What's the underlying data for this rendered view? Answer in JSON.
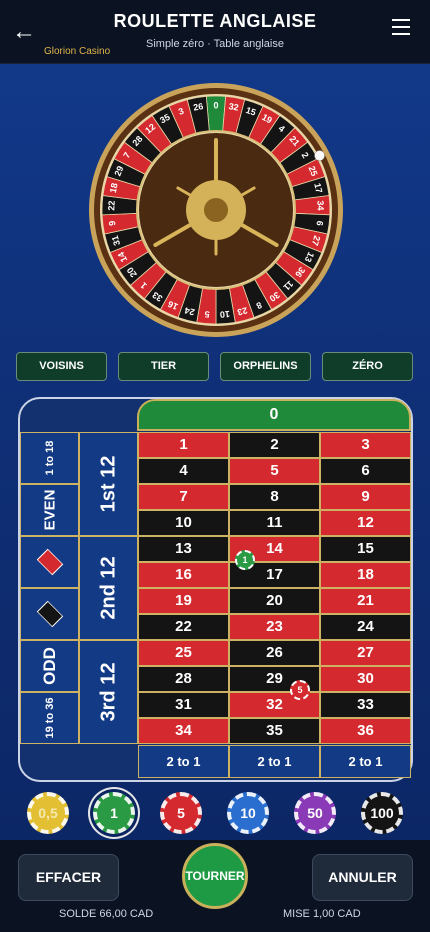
{
  "header": {
    "back_icon": "arrow-left-icon",
    "back_glyph": "←",
    "title": "ROULETTE ANGLAISE",
    "subtitle": "Simple zéro · Table anglaise",
    "brand": "Glorion Casino",
    "menu_icon": "hamburger-icon"
  },
  "wheel": {
    "sequence": [
      0,
      32,
      15,
      19,
      4,
      21,
      2,
      25,
      17,
      34,
      6,
      27,
      13,
      36,
      11,
      30,
      8,
      23,
      10,
      5,
      24,
      16,
      33,
      1,
      20,
      14,
      31,
      9,
      22,
      18,
      29,
      7,
      28,
      12,
      35,
      3,
      26
    ],
    "red_numbers": [
      1,
      3,
      5,
      7,
      9,
      12,
      14,
      16,
      18,
      19,
      21,
      23,
      25,
      27,
      30,
      32,
      34,
      36
    ],
    "colors": {
      "red": "#d42a2f",
      "black": "#141414",
      "green": "#1f8a3a",
      "gold": "#c9a35a",
      "wood": "#5a3213"
    }
  },
  "quick_bets": [
    "VOISINS",
    "TIER",
    "ORPHELINS",
    "ZÉRO"
  ],
  "table": {
    "zero": "0",
    "rows": [
      [
        "1",
        "2",
        "3"
      ],
      [
        "4",
        "5",
        "6"
      ],
      [
        "7",
        "8",
        "9"
      ],
      [
        "10",
        "11",
        "12"
      ],
      [
        "13",
        "14",
        "15"
      ],
      [
        "16",
        "17",
        "18"
      ],
      [
        "19",
        "20",
        "21"
      ],
      [
        "22",
        "23",
        "24"
      ],
      [
        "25",
        "26",
        "27"
      ],
      [
        "28",
        "29",
        "30"
      ],
      [
        "31",
        "32",
        "33"
      ],
      [
        "34",
        "35",
        "36"
      ]
    ],
    "dozens": [
      "1st 12",
      "2nd 12",
      "3rd 12"
    ],
    "low": "1 to 18",
    "even": "EVEN",
    "red_icon": "red-diamond-icon",
    "black_icon": "black-diamond-icon",
    "odd": "ODD",
    "high": "19 to 36",
    "columns": [
      "2 to 1",
      "2 to 1",
      "2 to 1"
    ],
    "placed_chips": [
      {
        "value": "1",
        "on": "14"
      },
      {
        "value": "5",
        "on": "29/30"
      }
    ]
  },
  "chips": [
    {
      "label": "0,5",
      "color": "#e2bf33"
    },
    {
      "label": "1",
      "color": "#2a9a44",
      "selected": true
    },
    {
      "label": "5",
      "color": "#d42a2f"
    },
    {
      "label": "10",
      "color": "#2a6fd0"
    },
    {
      "label": "50",
      "color": "#8a3ab6"
    },
    {
      "label": "100",
      "color": "#141414"
    }
  ],
  "actions": {
    "clear": "EFFACER",
    "spin": "TOURNER",
    "cancel": "ANNULER"
  },
  "status": {
    "balance": "SOLDE 66,00 CAD",
    "bet": "MISE 1,00 CAD"
  }
}
